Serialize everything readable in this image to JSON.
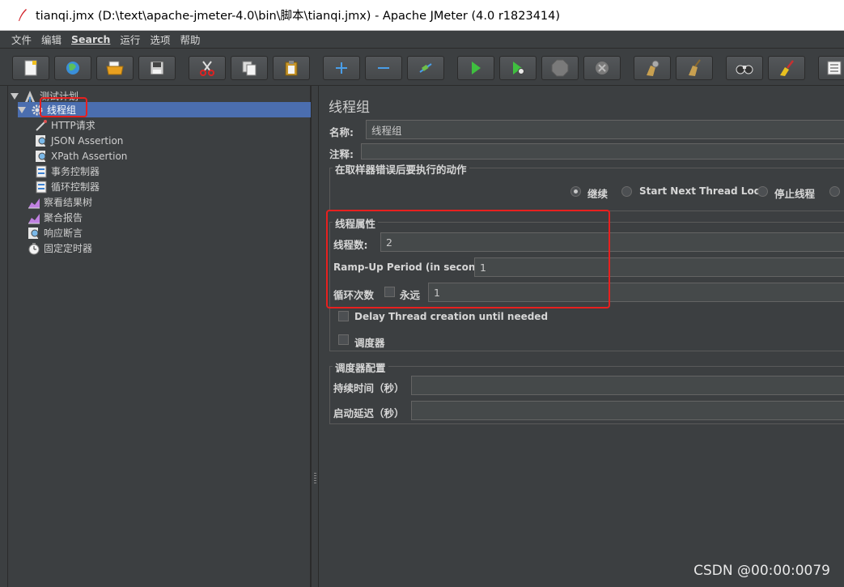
{
  "window": {
    "title": "tianqi.jmx (D:\\text\\apache-jmeter-4.0\\bin\\脚本\\tianqi.jmx) - Apache JMeter (4.0 r1823414)"
  },
  "menu": [
    "文件",
    "编辑",
    "Search",
    "运行",
    "选项",
    "帮助"
  ],
  "tree": {
    "root": "测试计划",
    "thread_group": "线程组",
    "children": [
      "HTTP请求",
      "JSON Assertion",
      "XPath Assertion",
      "事务控制器",
      "循环控制器"
    ],
    "siblings": [
      "察看结果树",
      "聚合报告",
      "响应断言",
      "固定定时器"
    ]
  },
  "panel": {
    "title": "线程组",
    "name_label": "名称:",
    "name_value": "线程组",
    "comment_label": "注释:",
    "sampler_error": {
      "title": "在取样器错误后要执行的动作",
      "options": [
        "继续",
        "Start Next Thread Loop",
        "停止线程"
      ],
      "selected": "继续"
    },
    "thread_props": {
      "title": "线程属性",
      "threads_label": "线程数:",
      "threads_value": "2",
      "rampup_label": "Ramp-Up Period (in seconds):",
      "rampup_value": "1",
      "loop_label": "循环次数",
      "forever_label": "永远",
      "loop_value": "1",
      "delay_label": "Delay Thread creation until needed",
      "scheduler_label": "调度器"
    },
    "scheduler_config": {
      "title": "调度器配置",
      "duration_label": "持续时间（秒）",
      "startup_delay_label": "启动延迟（秒）"
    }
  },
  "watermark": "CSDN @00:00:0079",
  "colors": {
    "selection": "#4b6eaf",
    "highlight": "#e8201f",
    "background": "#3c3f41"
  }
}
